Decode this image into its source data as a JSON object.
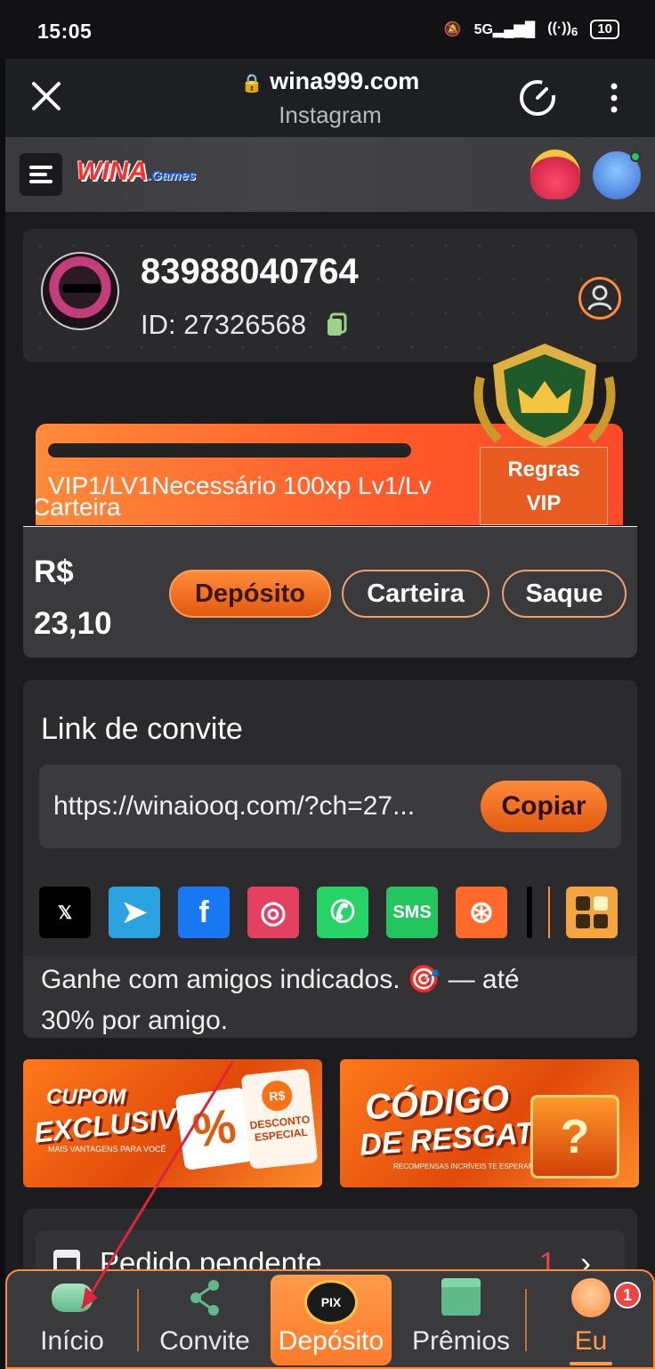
{
  "status_bar": {
    "time": "15:05",
    "network": "5G",
    "wifi_label": "6",
    "battery": "10"
  },
  "browser": {
    "url": "wina999.com",
    "source": "Instagram"
  },
  "app_header": {
    "logo_text": "WINA",
    "logo_suffix": ".Games"
  },
  "profile": {
    "username": "83988040764",
    "id_label": "ID: 27326568"
  },
  "vip": {
    "progress_text": "VIP1/LV1Necessário 100xp Lv1/Lv",
    "overlap_text": "Carteira",
    "rules_line1": "Regras",
    "rules_line2": "VIP",
    "progress": 0
  },
  "wallet": {
    "currency": "R$",
    "balance": "23,10",
    "deposit_label": "Depósito",
    "wallet_label": "Carteira",
    "withdraw_label": "Saque"
  },
  "invite": {
    "title": "Link de convite",
    "url": "https://winaiooq.com/?ch=27...",
    "copy_label": "Copiar",
    "share": [
      {
        "name": "x",
        "glyph": "𝕏",
        "color": "#000000"
      },
      {
        "name": "telegram",
        "glyph": "➤",
        "color": "#2aa3e0"
      },
      {
        "name": "facebook",
        "glyph": "f",
        "color": "#1877f2"
      },
      {
        "name": "instagram",
        "glyph": "◎",
        "color": "#e4405f"
      },
      {
        "name": "whatsapp",
        "glyph": "✆",
        "color": "#25d366"
      },
      {
        "name": "sms",
        "glyph": "SMS",
        "color": "#22c55e"
      },
      {
        "name": "kwai",
        "glyph": "⊛",
        "color": "#ff6a2a"
      }
    ],
    "description_1": "Ganhe com amigos indicados. 🎯 — até",
    "description_2": "30% por amigo."
  },
  "banners": {
    "cupom_line1": "CUPOM",
    "cupom_line2": "EXCLUSIVO",
    "cupom_small": "MAIS VANTAGENS PARA VOCÊ",
    "cupom_ticket_currency": "R$",
    "cupom_ticket_text": "DESCONTO ESPECIAL",
    "codigo_line1": "CÓDIGO",
    "codigo_line2": "DE RESGATE",
    "codigo_small": "RECOMPENSAS INCRÍVEIS TE ESPERAM!"
  },
  "pending": {
    "title": "Pedido pendente",
    "count": "1"
  },
  "nav": {
    "items": [
      {
        "label": "Início"
      },
      {
        "label": "Convite"
      },
      {
        "label": "Depósito",
        "badge": "PIX"
      },
      {
        "label": "Prêmios"
      },
      {
        "label": "Eu",
        "badge_count": "1"
      }
    ]
  },
  "colors": {
    "accent": "#ff7a2a",
    "bg": "#1c1c1e",
    "card": "#2b2b2e"
  }
}
